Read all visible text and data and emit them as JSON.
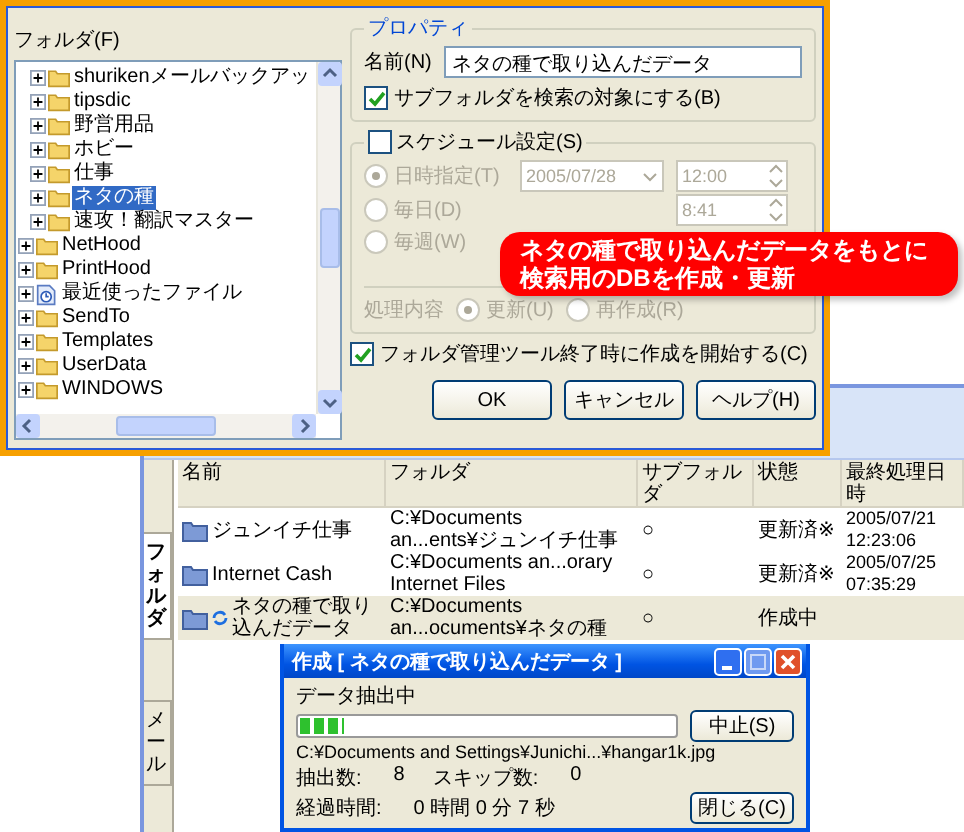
{
  "folder_dialog": {
    "folder_label": "フォルダ(F)",
    "tree": [
      {
        "children": [
          {
            "label": "shurikenメールバックアッ",
            "kind": "folder",
            "selected": false
          },
          {
            "label": "tipsdic",
            "kind": "folder",
            "selected": false
          },
          {
            "label": "野営用品",
            "kind": "folder",
            "selected": false
          },
          {
            "label": "ホビー",
            "kind": "folder",
            "selected": false
          },
          {
            "label": "仕事",
            "kind": "folder",
            "selected": false
          },
          {
            "label": "ネタの種",
            "kind": "folder",
            "selected": true
          },
          {
            "label": "速攻！翻訳マスター",
            "kind": "folder",
            "selected": false
          }
        ]
      },
      {
        "label": "NetHood",
        "kind": "folder",
        "selected": false
      },
      {
        "label": "PrintHood",
        "kind": "folder",
        "selected": false
      },
      {
        "label": "最近使ったファイル",
        "kind": "recent",
        "selected": false
      },
      {
        "label": "SendTo",
        "kind": "folder",
        "selected": false
      },
      {
        "label": "Templates",
        "kind": "folder",
        "selected": false
      },
      {
        "label": "UserData",
        "kind": "folder",
        "selected": false
      },
      {
        "label": "WINDOWS",
        "kind": "folder",
        "selected": false
      }
    ],
    "properties": {
      "title": "プロパティ",
      "name_label": "名前(N)",
      "name_value": "ネタの種で取り込んだデータ",
      "subfolder": {
        "label": "サブフォルダを検索の対象にする(B)",
        "checked": true
      }
    },
    "schedule": {
      "label": "スケジュール設定(S)",
      "checked": false,
      "rows": [
        {
          "label": "日時指定(T)",
          "selected": true,
          "date": "2005/07/28",
          "time": "12:00"
        },
        {
          "label": "毎日(D)",
          "selected": false,
          "time": "8:41"
        },
        {
          "label": "毎週(W)",
          "selected": false
        }
      ],
      "action_label": "処理内容",
      "actions": [
        {
          "label": "更新(U)",
          "selected": true
        },
        {
          "label": "再作成(R)",
          "selected": false
        }
      ]
    },
    "start_on_exit": {
      "label": "フォルダ管理ツール終了時に作成を開始する(C)",
      "checked": true
    },
    "buttons": [
      "OK",
      "キャンセル",
      "ヘルプ(H)"
    ]
  },
  "callout": {
    "lines": [
      "ネタの種で取り込んだデータをもとに",
      "検索用のDBを作成・更新"
    ]
  },
  "main_window": {
    "side_tabs": [
      {
        "label": "フォルダ",
        "selected": true
      },
      {
        "label": "メール",
        "selected": false
      }
    ],
    "table": {
      "columns": [
        "名前",
        "フォルダ",
        "サブフォルダ",
        "状態",
        "最終処理日時"
      ],
      "rows": [
        {
          "name": "ジュンイチ仕事",
          "folder": "C:¥Documents an...ents¥ジュンイチ仕事",
          "subfolder": "○",
          "status": "更新済※",
          "updated": "2005/07/21 12:23:06",
          "processing": false,
          "selected": false
        },
        {
          "name": "Internet Cash",
          "folder": "C:¥Documents an...orary Internet Files",
          "subfolder": "○",
          "status": "更新済※",
          "updated": "2005/07/25 07:35:29",
          "processing": false,
          "selected": false
        },
        {
          "name": "ネタの種で取り込んだデータ",
          "folder": "C:¥Documents an...ocuments¥ネタの種",
          "subfolder": "○",
          "status": "作成中",
          "processing": true,
          "selected": true
        }
      ]
    }
  },
  "progress_dialog": {
    "title": "作成 [ ネタの種で取り込んだデータ ]",
    "status": "データ抽出中",
    "level": 0.12,
    "stop_button": "中止(S)",
    "path": "C:¥Documents and Settings¥Junichi...¥hangar1k.jpg",
    "stats": [
      {
        "label": "抽出数:",
        "value": "8"
      },
      {
        "label": "スキップ数:",
        "value": "0"
      }
    ],
    "elapsed_label": "経過時間:",
    "elapsed": "0 時間 0 分 7 秒",
    "close_button": "閉じる(C)"
  }
}
